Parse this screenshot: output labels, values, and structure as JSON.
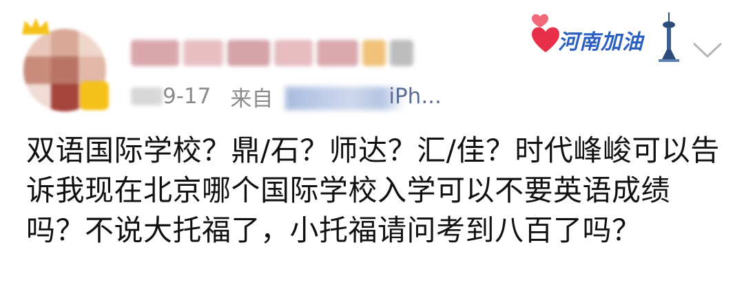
{
  "post": {
    "username": "",
    "date": "9-17",
    "from_label": "来自",
    "source_visible_tail": "iPh...",
    "badge_label": "河南加油",
    "body_text": "双语国际学校？鼎/石？师达？汇/佳？时代峰峻可以告诉我现在北京哪个国际学校入学可以不要英语成绩吗？不说大托福了，小托福请问考到八百了吗？"
  },
  "icons": {
    "expand": "chevron-down-icon",
    "hearts": "heart-icon",
    "tower": "tower-icon",
    "crown": "crown-icon"
  },
  "colors": {
    "meta_text": "#8a8a8a",
    "source_link": "#5b6d93",
    "badge_blue": "#2b5fbf",
    "heart_red": "#e8304a",
    "body_text": "#111111"
  }
}
